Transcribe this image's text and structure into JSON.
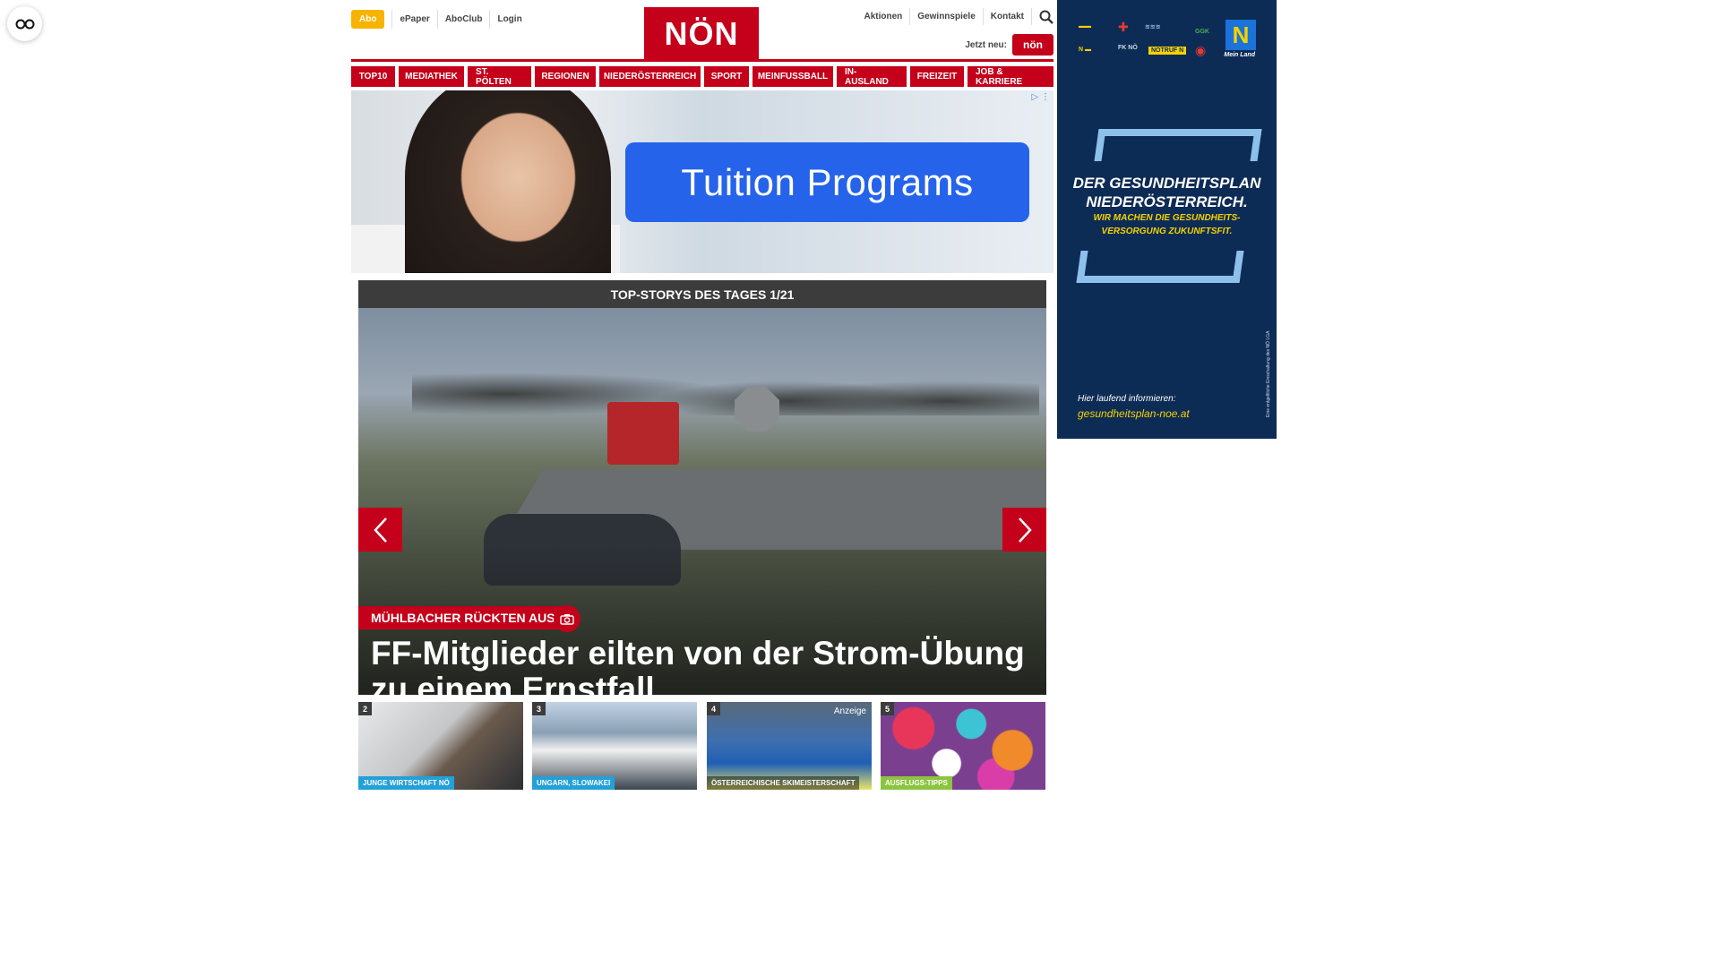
{
  "accessibility": {
    "icon": "accessibility-glasses-icon"
  },
  "header": {
    "topnav": {
      "abo": "Abo",
      "links": [
        "ePaper",
        "AboClub",
        "Login"
      ]
    },
    "logo": "NÖN",
    "rightnav": {
      "links": [
        "Aktionen",
        "Gewinnspiele",
        "Kontakt"
      ],
      "search_icon": "search-icon"
    },
    "jetzt_neu": "Jetzt neu:",
    "mini_logo": "nön"
  },
  "mainnav": [
    "TOP10",
    "MEDIATHEK",
    "ST. PÖLTEN",
    "REGIONEN",
    "NIEDERÖSTERREICH",
    "SPORT",
    "MEINFUSSBALL",
    "IN-AUSLAND",
    "FREIZEIT",
    "JOB & KARRIERE"
  ],
  "ad_banner": {
    "cta": "Tuition Programs",
    "adchoice": "▷ ⋮"
  },
  "top_stories": {
    "bar_title": "TOP-STORYS DES TAGES 1/21",
    "kicker": "MÜHLBACHER RÜCKTEN AUS",
    "headline": "FF-Mitglieder eilten von der Strom-Übung zu einem Ernstfall",
    "prev_icon": "chevron-left-icon",
    "next_icon": "chevron-right-icon"
  },
  "thumbnails": [
    {
      "num": "2",
      "tag": "JUNGE WIRTSCHAFT NÖ",
      "anzeige": ""
    },
    {
      "num": "3",
      "tag": "UNGARN, SLOWAKEI",
      "anzeige": ""
    },
    {
      "num": "4",
      "tag": "ÖSTERREICHISCHE SKIMEISTERSCHAFT",
      "anzeige": "Anzeige"
    },
    {
      "num": "5",
      "tag": "AUSFLUGS-TIPPS",
      "anzeige": ""
    }
  ],
  "side_ad": {
    "headline_1": "DER GESUNDHEITSPLAN",
    "headline_2": "NIEDERÖSTERREICH.",
    "sub_1": "WIR MACHEN DIE GESUNDHEITS-",
    "sub_2": "VERSORGUNG ZUKUNFTSFIT.",
    "info": "Hier laufend informieren:",
    "url": "gesundheitsplan-noe.at",
    "mein_land": "Mein Land",
    "vertical_note": "Eine entgeltliche Einschaltung des NÖ LGA",
    "logo_labels": [
      "GGK",
      "FK NÖ",
      "NOTRUF N"
    ]
  },
  "colors": {
    "brand_red": "#c4001a",
    "abo_yellow": "#f6b400",
    "ad_blue": "#2563eb",
    "side_ad_navy": "#0d2c55"
  }
}
